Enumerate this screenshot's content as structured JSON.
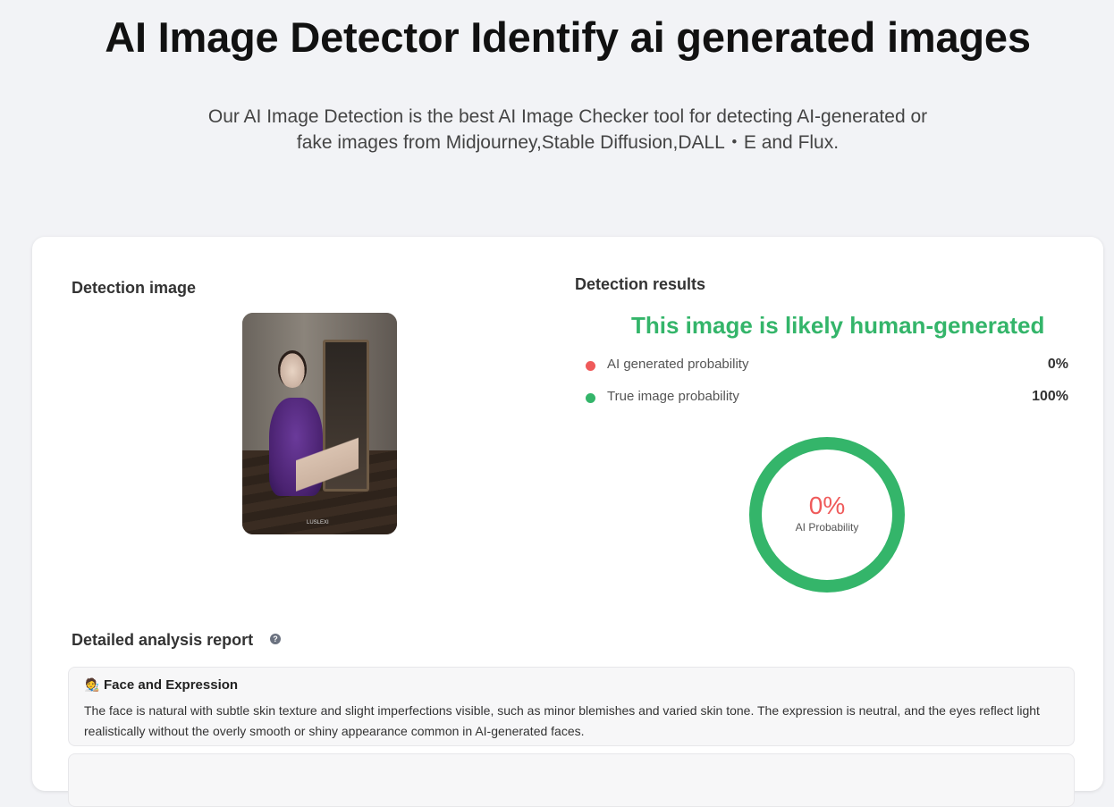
{
  "hero": {
    "title": "AI Image Detector Identify ai generated images",
    "subtitle_line1": "Our AI Image Detection is the best AI Image Checker tool for detecting AI-generated or",
    "subtitle_line2": "fake images from Midjourney,Stable Diffusion,DALL・E and Flux."
  },
  "detection_image": {
    "heading": "Detection image",
    "watermark": "LUSLEXI"
  },
  "detection_results": {
    "heading": "Detection results",
    "verdict": "This image is likely human-generated",
    "verdict_color": "#34b56a",
    "rows": [
      {
        "label": "AI generated probability",
        "value": "0%",
        "dot_color": "#ef5a5a"
      },
      {
        "label": "True image probability",
        "value": "100%",
        "dot_color": "#34b56a"
      }
    ],
    "gauge": {
      "percent_text": "0%",
      "caption": "AI Probability",
      "ai_fraction": 0.0,
      "ring_color": "#34b56a",
      "ai_color": "#ef5a5a"
    }
  },
  "report": {
    "heading": "Detailed analysis report",
    "help_icon": "question-circle-icon",
    "items": [
      {
        "icon": "person-emoji-icon",
        "emoji": "🧑‍🎨",
        "title": "Face and Expression",
        "text": "The face is natural with subtle skin texture and slight imperfections visible, such as minor blemishes and varied skin tone. The expression is neutral, and the eyes reflect light realistically without the overly smooth or shiny appearance common in AI-generated faces."
      }
    ]
  }
}
